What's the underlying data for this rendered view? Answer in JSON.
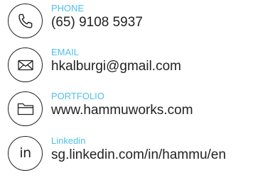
{
  "contacts": [
    {
      "label": "PHONE",
      "value": "(65) 9108 5937",
      "icon": "phone-icon"
    },
    {
      "label": "EMAIL",
      "value": "hkalburgi@gmail.com",
      "icon": "envelope-icon"
    },
    {
      "label": "PORTFOLIO",
      "value": "www.hammuworks.com",
      "icon": "folder-icon"
    },
    {
      "label": "Linkedin",
      "value": "sg.linkedin.com/in/hammu/en",
      "icon": "linkedin-icon",
      "icon_text": "in"
    }
  ],
  "colors": {
    "label": "#4fc0ea",
    "value": "#222222",
    "icon": "#222222"
  }
}
